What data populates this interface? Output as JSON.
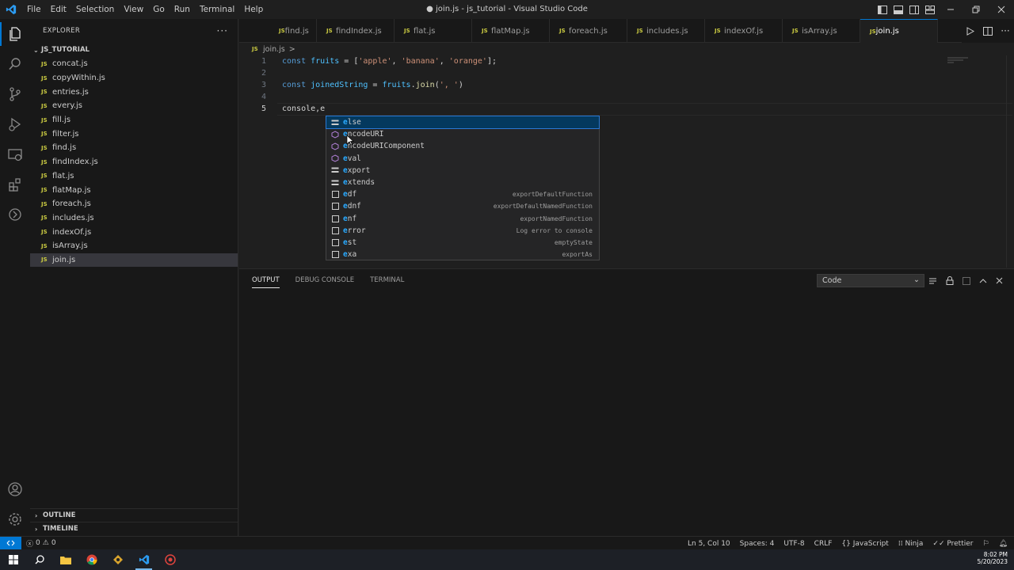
{
  "titlebar": {
    "menu": [
      "File",
      "Edit",
      "Selection",
      "View",
      "Go",
      "Run",
      "Terminal",
      "Help"
    ],
    "window_title": "● join.js - js_tutorial - Visual Studio Code"
  },
  "activity_bar": {
    "icons": [
      "files-icon",
      "search-icon",
      "source-control-icon",
      "run-debug-icon",
      "remote-explorer-icon",
      "extensions-icon",
      "timeline-git-icon"
    ],
    "bottom_icons": [
      "account-icon",
      "settings-gear-icon"
    ]
  },
  "sidebar": {
    "header": "EXPLORER",
    "folder": "JS_TUTORIAL",
    "files": [
      "concat.js",
      "copyWithin.js",
      "entries.js",
      "every.js",
      "fill.js",
      "filter.js",
      "find.js",
      "findIndex.js",
      "flat.js",
      "flatMap.js",
      "foreach.js",
      "includes.js",
      "indexOf.js",
      "isArray.js",
      "join.js"
    ],
    "selected_file": "join.js",
    "file_badge": "JS",
    "outline": "OUTLINE",
    "timeline": "TIMELINE"
  },
  "tabs": [
    {
      "label": "find.js"
    },
    {
      "label": "findIndex.js"
    },
    {
      "label": "flat.js"
    },
    {
      "label": "flatMap.js"
    },
    {
      "label": "foreach.js"
    },
    {
      "label": "includes.js"
    },
    {
      "label": "indexOf.js"
    },
    {
      "label": "isArray.js"
    },
    {
      "label": "join.js"
    }
  ],
  "active_tab": "join.js",
  "breadcrumb": {
    "file": "join.js",
    "sep": ">",
    "badge": "JS"
  },
  "editor": {
    "line_numbers": [
      "1",
      "2",
      "3",
      "4",
      "5"
    ],
    "line1": {
      "kw": "const",
      "var": "fruits",
      "op": " = [",
      "s1": "'apple'",
      "c1": ", ",
      "s2": "'banana'",
      "c2": ", ",
      "s3": "'orange'",
      "end": "];"
    },
    "line3": {
      "kw": "const",
      "var": "joinedString",
      "op": " = ",
      "obj": "fruits",
      "dot": ".",
      "fn": "join",
      "open": "(",
      "s": "', '",
      "close": ")"
    },
    "line5": {
      "text": "console,e"
    }
  },
  "suggest": {
    "items": [
      {
        "icon": "keyword-icon",
        "pre": "",
        "match": "e",
        "rest": "lse",
        "detail": ""
      },
      {
        "icon": "method-icon",
        "pre": "",
        "match": "e",
        "rest": "ncodeURI",
        "detail": ""
      },
      {
        "icon": "method-icon",
        "pre": "",
        "match": "e",
        "rest": "ncodeURIComponent",
        "detail": ""
      },
      {
        "icon": "method-icon",
        "pre": "",
        "match": "e",
        "rest": "val",
        "detail": ""
      },
      {
        "icon": "keyword-icon",
        "pre": "",
        "match": "e",
        "rest": "xport",
        "detail": ""
      },
      {
        "icon": "keyword-icon",
        "pre": "",
        "match": "e",
        "rest": "xtends",
        "detail": ""
      },
      {
        "icon": "snippet-icon",
        "pre": "",
        "match": "e",
        "rest": "df",
        "detail": "exportDefaultFunction"
      },
      {
        "icon": "snippet-icon",
        "pre": "",
        "match": "e",
        "rest": "dnf",
        "detail": "exportDefaultNamedFunction"
      },
      {
        "icon": "snippet-icon",
        "pre": "",
        "match": "e",
        "rest": "nf",
        "detail": "exportNamedFunction"
      },
      {
        "icon": "snippet-icon",
        "pre": "",
        "match": "e",
        "rest": "rror",
        "detail": "Log error to console"
      },
      {
        "icon": "snippet-icon",
        "pre": "",
        "match": "e",
        "rest": "st",
        "detail": "emptyState"
      },
      {
        "icon": "snippet-icon",
        "pre": "",
        "match": "e",
        "rest": "xa",
        "detail": "exportAs"
      }
    ]
  },
  "panel": {
    "tabs": [
      "OUTPUT",
      "DEBUG CONSOLE",
      "TERMINAL"
    ],
    "active_tab": "OUTPUT",
    "channel": "Code"
  },
  "statusbar": {
    "errors": "0",
    "warnings": "0",
    "position": "Ln 5, Col 10",
    "spaces": "Spaces: 4",
    "encoding": "UTF-8",
    "eol": "CRLF",
    "language": "JavaScript",
    "ninja": "Ninja",
    "prettier": "Prettier"
  },
  "taskbar": {
    "time": "8:02 PM",
    "date": "5/20/2023"
  },
  "colors": {
    "accent": "#0078d4",
    "js_badge": "#cbcb41",
    "match": "#2aaaff"
  }
}
